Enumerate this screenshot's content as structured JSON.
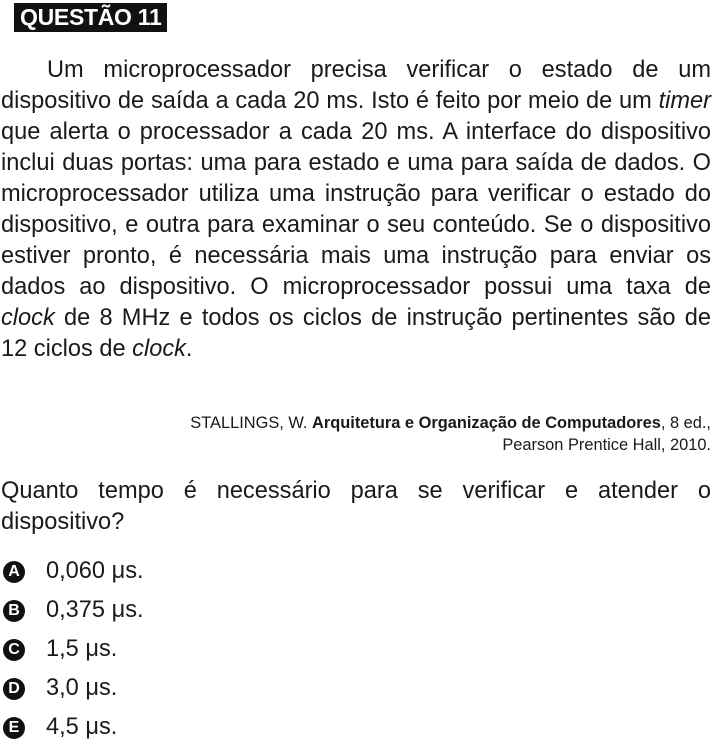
{
  "header": {
    "title": "QUESTÃO 11"
  },
  "passage": {
    "part1": "Um microprocessador precisa verificar o estado de um dispositivo de saída a cada 20 ms. Isto é feito por meio de um ",
    "italic1": "timer",
    "part2": " que alerta o processador a cada 20 ms. A interface do dispositivo inclui duas portas: uma para estado e uma para saída de dados. O microprocessador utiliza uma instrução para verificar o estado do dispositivo, e outra para examinar o seu conteúdo. Se o dispositivo estiver pronto, é necessária mais uma instrução para enviar os dados ao dispositivo. O microprocessador possui uma taxa de ",
    "italic2": "clock",
    "part3": " de 8 MHz e todos os ciclos de instrução pertinentes são de 12 ciclos de ",
    "italic3": "clock",
    "part4": "."
  },
  "citation": {
    "author": "STALLINGS, W. ",
    "title": "Arquitetura e Organização de Computadores",
    "edition": ", 8 ed.,",
    "publisher": "Pearson Prentice Hall, 2010."
  },
  "question": {
    "text": "Quanto tempo é necessário para se verificar e atender o dispositivo?"
  },
  "options": [
    {
      "letter": "A",
      "text": "0,060 μs."
    },
    {
      "letter": "B",
      "text": "0,375 μs."
    },
    {
      "letter": "C",
      "text": "1,5 μs."
    },
    {
      "letter": "D",
      "text": "3,0 μs."
    },
    {
      "letter": "E",
      "text": "4,5 μs."
    }
  ]
}
